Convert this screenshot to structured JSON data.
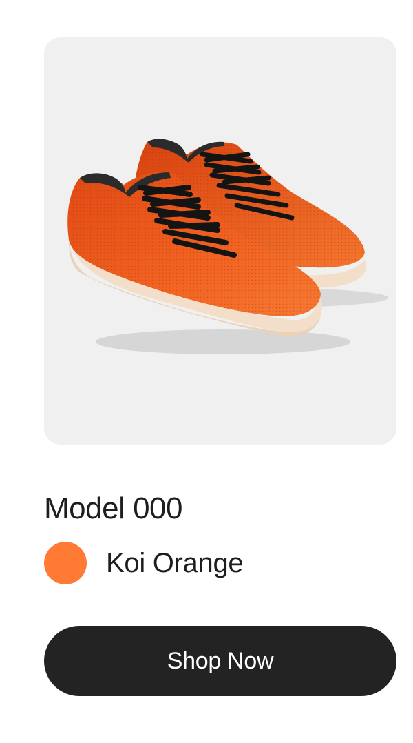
{
  "product": {
    "name": "Model 000",
    "image_icon": "orange-sneakers-image"
  },
  "color": {
    "name": "Koi Orange",
    "swatch_hex": "#ff7b34"
  },
  "cta": {
    "label": "Shop Now",
    "bg_hex": "#232323"
  },
  "theme": {
    "image_bg": "#f0f0f0",
    "text": "#1e1e1e"
  }
}
